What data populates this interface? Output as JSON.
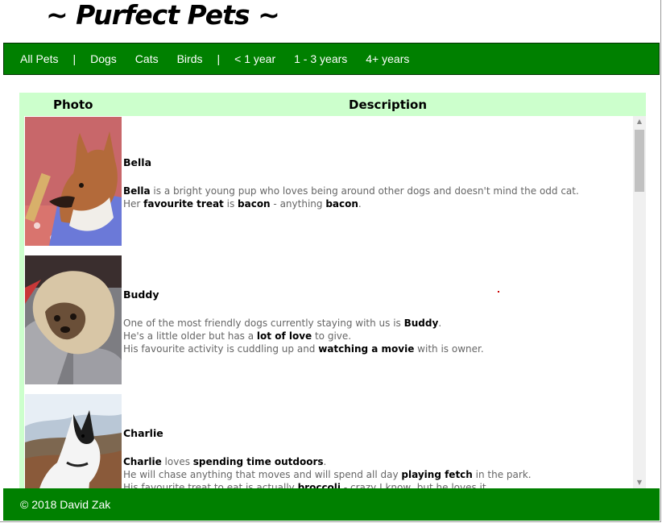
{
  "site": {
    "title": "~ Purfect Pets ~"
  },
  "nav": {
    "all_pets": "All Pets",
    "sep1": "|",
    "dogs": "Dogs",
    "cats": "Cats",
    "birds": "Birds",
    "sep2": "|",
    "age_lt1": "< 1 year",
    "age_1_3": "1 - 3 years",
    "age_4plus": "4+ years"
  },
  "table": {
    "header_photo": "Photo",
    "header_description": "Description"
  },
  "pets": [
    {
      "name": "Bella",
      "line1": [
        "Bella",
        " is a bright young pup who loves being around other dogs and doesn't mind the odd cat."
      ],
      "line2": [
        "Her ",
        "favourite treat",
        " is ",
        "bacon",
        " - anything ",
        "bacon",
        "."
      ]
    },
    {
      "name": "Buddy",
      "line1": [
        "One of the most friendly dogs currently staying with us is ",
        "Buddy",
        "."
      ],
      "line2": [
        "He's a little older but has a ",
        "lot of love",
        " to give."
      ],
      "line3": [
        "His favourite activity is cuddling up and ",
        "watching a movie",
        " with is owner."
      ]
    },
    {
      "name": "Charlie",
      "line1": [
        "Charlie",
        " loves ",
        "spending time outdoors",
        "."
      ],
      "line2": [
        "He will chase anything that moves and will spend all day ",
        "playing fetch",
        " in the park."
      ],
      "line3": [
        "His favourite treat to eat is actually ",
        "broccoli",
        " - crazy I know, but he loves it."
      ]
    }
  ],
  "footer": {
    "text": "© 2018 David Zak"
  },
  "colors": {
    "nav_green": "#008000",
    "table_header_bg": "#ccffcc",
    "text_gray": "#666666"
  }
}
